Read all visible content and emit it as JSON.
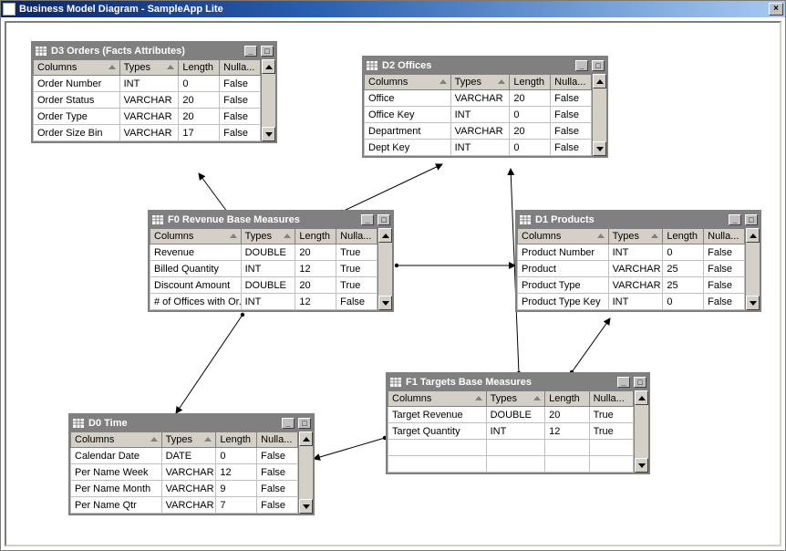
{
  "window": {
    "title": "Business Model Diagram - SampleApp Lite",
    "close_label": "×"
  },
  "headers": {
    "columns": "Columns",
    "types": "Types",
    "length": "Length",
    "nullable": "Nulla..."
  },
  "entities": {
    "d3": {
      "title": "D3 Orders (Facts Attributes)",
      "rows": [
        [
          "Order Number",
          "INT",
          "0",
          "False"
        ],
        [
          "Order Status",
          "VARCHAR",
          "20",
          "False"
        ],
        [
          "Order Type",
          "VARCHAR",
          "20",
          "False"
        ],
        [
          "Order Size Bin",
          "VARCHAR",
          "17",
          "False"
        ]
      ]
    },
    "d2": {
      "title": "D2 Offices",
      "rows": [
        [
          "Office",
          "VARCHAR",
          "20",
          "False"
        ],
        [
          "Office Key",
          "INT",
          "0",
          "False"
        ],
        [
          "Department",
          "VARCHAR",
          "20",
          "False"
        ],
        [
          "Dept Key",
          "INT",
          "0",
          "False"
        ]
      ]
    },
    "f0": {
      "title": "F0 Revenue Base Measures",
      "rows": [
        [
          "Revenue",
          "DOUBLE",
          "20",
          "True"
        ],
        [
          "Billed Quantity",
          "INT",
          "12",
          "True"
        ],
        [
          "Discount Amount",
          "DOUBLE",
          "20",
          "True"
        ],
        [
          "# of Offices with Or...",
          "INT",
          "12",
          "False"
        ]
      ]
    },
    "d1": {
      "title": "D1 Products",
      "rows": [
        [
          "Product Number",
          "INT",
          "0",
          "False"
        ],
        [
          "Product",
          "VARCHAR",
          "25",
          "False"
        ],
        [
          "Product Type",
          "VARCHAR",
          "25",
          "False"
        ],
        [
          "Product Type Key",
          "INT",
          "0",
          "False"
        ]
      ]
    },
    "f1": {
      "title": "F1 Targets Base Measures",
      "rows": [
        [
          "Target Revenue",
          "DOUBLE",
          "20",
          "True"
        ],
        [
          "Target Quantity",
          "INT",
          "12",
          "True"
        ],
        [
          "",
          "",
          "",
          ""
        ],
        [
          "",
          "",
          "",
          ""
        ]
      ]
    },
    "d0": {
      "title": "D0 Time",
      "rows": [
        [
          "Calendar Date",
          "DATE",
          "0",
          "False"
        ],
        [
          "Per Name Week",
          "VARCHAR",
          "12",
          "False"
        ],
        [
          "Per Name Month",
          "VARCHAR",
          "9",
          "False"
        ],
        [
          "Per Name Qtr",
          "VARCHAR",
          "7",
          "False"
        ]
      ]
    }
  }
}
